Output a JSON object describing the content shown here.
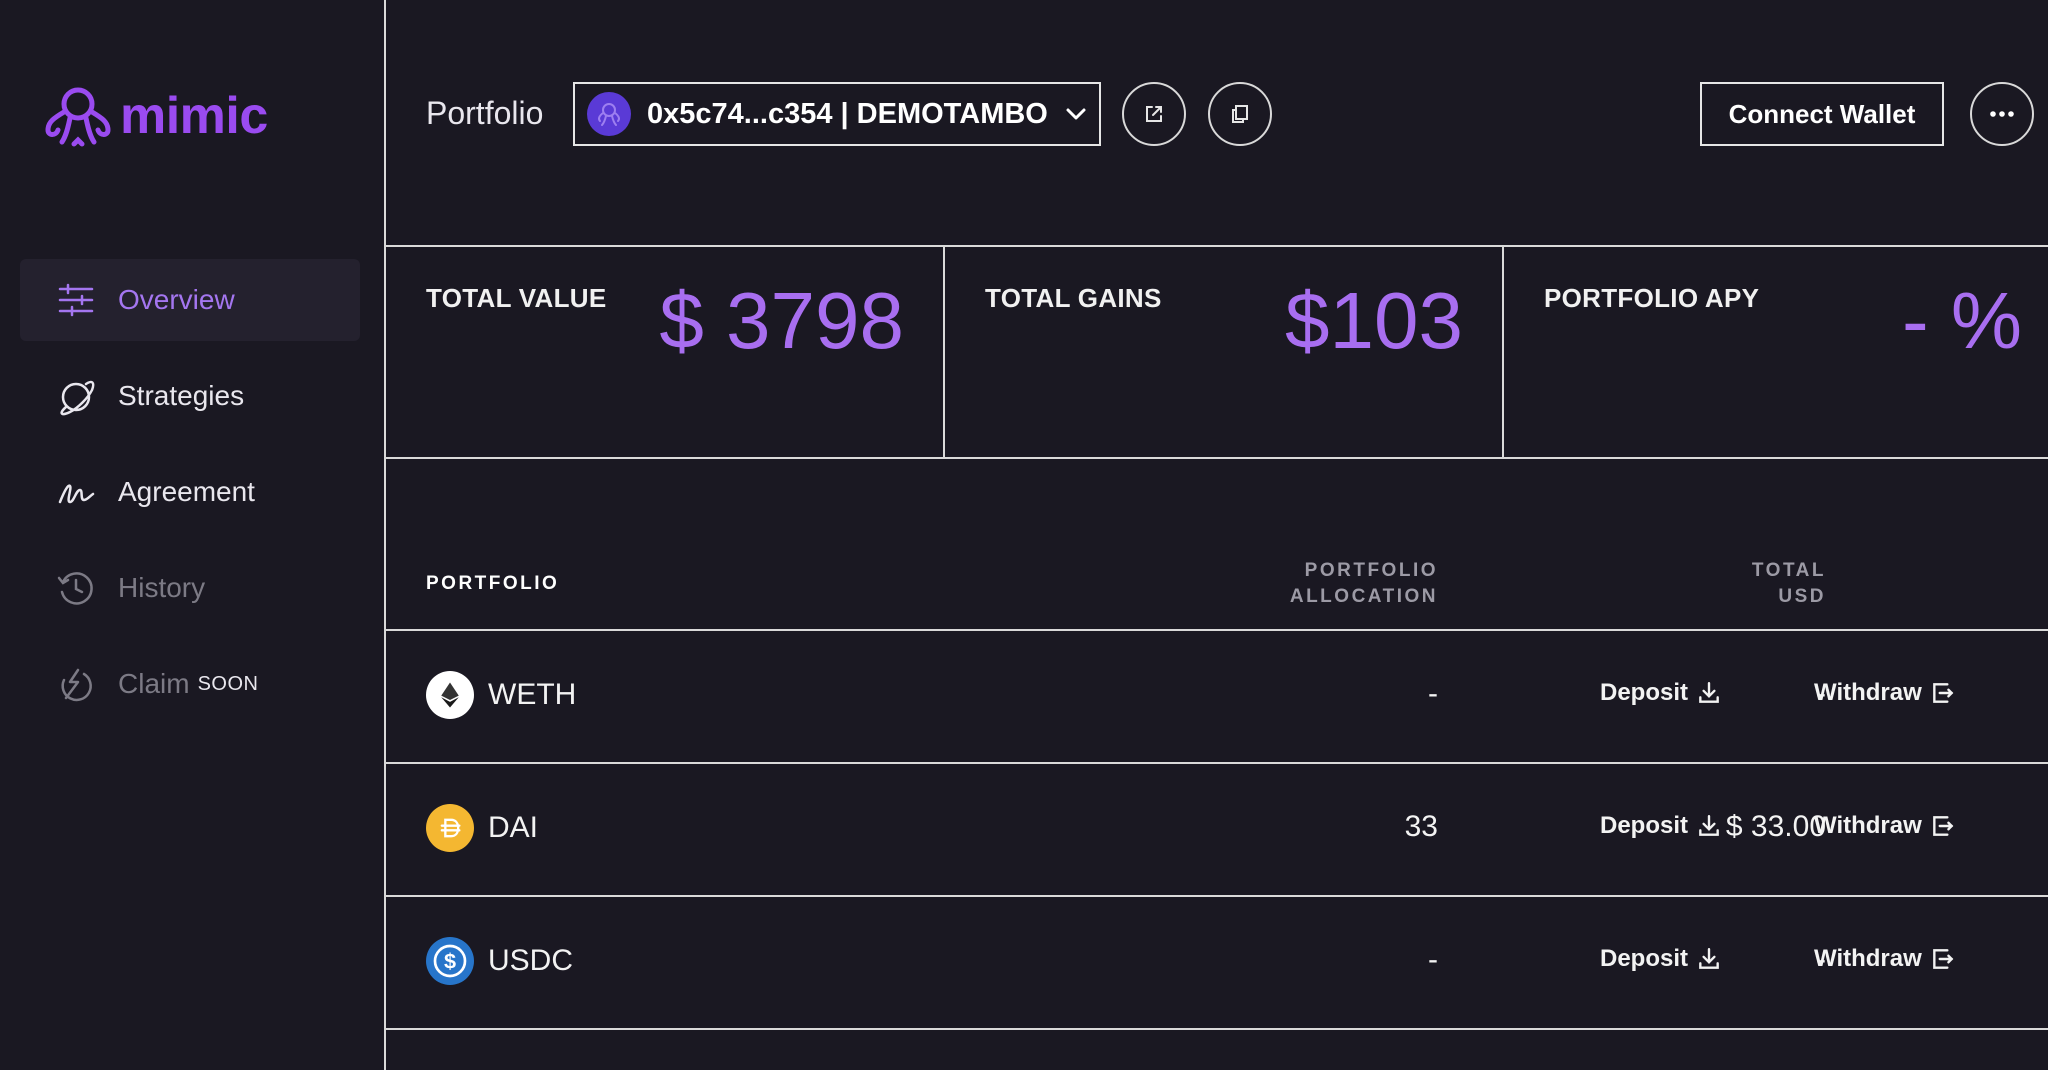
{
  "app": {
    "logo_text": "mimic"
  },
  "sidebar": {
    "items": [
      {
        "label": "Overview",
        "icon": "sliders-icon",
        "active": true
      },
      {
        "label": "Strategies",
        "icon": "planet-icon"
      },
      {
        "label": "Agreement",
        "icon": "signature-icon"
      },
      {
        "label": "History",
        "icon": "history-icon"
      },
      {
        "label": "Claim",
        "badge": "SOON",
        "icon": "claim-icon"
      }
    ]
  },
  "header": {
    "title": "Portfolio",
    "wallet_label": "0x5c74...c354 | DEMOTAMBO",
    "connect_label": "Connect Wallet"
  },
  "stats": {
    "total_value": {
      "label": "TOTAL VALUE",
      "value": "$ 3798"
    },
    "total_gains": {
      "label": "TOTAL GAINS",
      "value": "$103"
    },
    "portfolio_apy": {
      "label": "PORTFOLIO APY",
      "value": "- %"
    }
  },
  "table": {
    "headers": {
      "portfolio": "PORTFOLIO",
      "allocation_1": "PORTFOLIO",
      "allocation_2": "ALLOCATION",
      "total_1": "TOTAL",
      "total_2": "USD"
    },
    "rows": [
      {
        "token": "WETH",
        "allocation": "-",
        "total_usd": "-",
        "deposit": "Deposit",
        "withdraw": "Withdraw"
      },
      {
        "token": "DAI",
        "allocation": "33",
        "total_usd": "$ 33.00",
        "deposit": "Deposit",
        "withdraw": "Withdraw"
      },
      {
        "token": "USDC",
        "allocation": "-",
        "total_usd": "-",
        "deposit": "Deposit",
        "withdraw": "Withdraw"
      }
    ]
  },
  "colors": {
    "background": "#1a1822",
    "accent": "#a86ef0",
    "brand": "#9a4bf0",
    "divider": "#d9d9d9",
    "dai": "#f4b731",
    "usdc": "#2775ca"
  }
}
